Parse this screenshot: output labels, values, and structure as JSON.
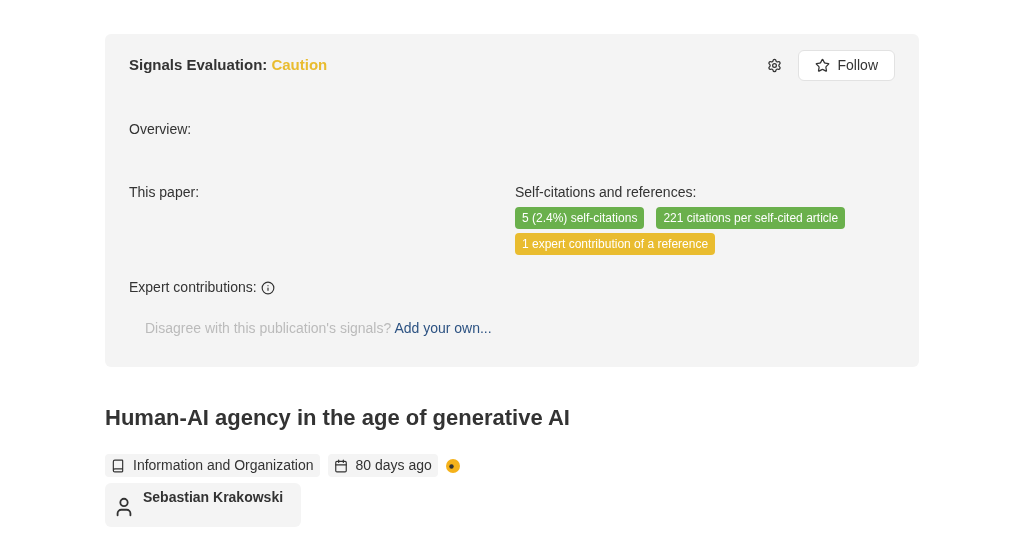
{
  "signals": {
    "title": "Signals Evaluation:",
    "verdict": "Caution",
    "follow": "Follow",
    "overview": "Overview:",
    "this_paper": "This paper:",
    "self_citations_title": "Self-citations and references:",
    "tags": [
      {
        "label": "5 (2.4%) self-citations",
        "color": "#6ab04c"
      },
      {
        "label": "221 citations per self-cited article",
        "color": "#6ab04c"
      },
      {
        "label": "1 expert contribution of a reference",
        "color": "#e9bc2f"
      }
    ],
    "expert": "Expert contributions:",
    "disagree": "Disagree with this publication's signals?",
    "add_link": "Add your own..."
  },
  "paper": {
    "title": "Human-AI agency in the age of generative AI",
    "journal": "Information and Organization",
    "date": "80 days ago",
    "author": "Sebastian Krakowski"
  }
}
